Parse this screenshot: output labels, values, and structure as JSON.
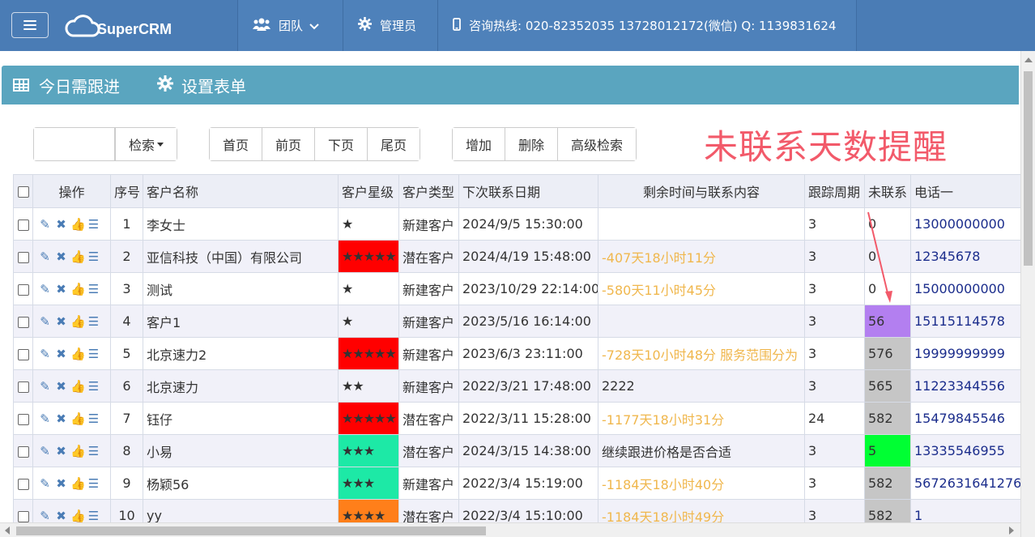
{
  "navbar": {
    "brand": "SuperCRM",
    "team_label": "团队",
    "admin_label": "管理员",
    "hotline": "咨询热线: 020-82352035 13728012172(微信) Q: 1139831624"
  },
  "panel": {
    "title": "今日需跟进",
    "settings": "设置表单"
  },
  "toolbar": {
    "search_value": "",
    "search_label": "检索",
    "first": "首页",
    "prev": "前页",
    "next": "下页",
    "last": "尾页",
    "add": "增加",
    "delete": "删除",
    "advanced": "高级检索"
  },
  "annotation": "未联系天数提醒",
  "table": {
    "headers": {
      "op": "操作",
      "idx": "序号",
      "name": "客户名称",
      "star": "客户星级",
      "type": "客户类型",
      "next_date": "下次联系日期",
      "remain": "剩余时间与联系内容",
      "cycle": "跟踪周期",
      "uncontacted": "未联系",
      "phone": "电话一"
    },
    "rows": [
      {
        "idx": "1",
        "name": "李女士",
        "stars": "★",
        "star_bg": "",
        "type": "新建客户",
        "date": "2024/9/5 15:30:00",
        "remain": "",
        "remain_warn": false,
        "cycle": "3",
        "days": "0",
        "days_bg": "",
        "phone": "13000000000"
      },
      {
        "idx": "2",
        "name": "亚信科技（中国）有限公司",
        "stars": "★★★★★",
        "star_bg": "#ff0000",
        "type": "潜在客户",
        "date": "2024/4/19 15:48:00",
        "remain": "-407天18小时11分",
        "remain_warn": true,
        "cycle": "3",
        "days": "0",
        "days_bg": "",
        "phone": "12345678"
      },
      {
        "idx": "3",
        "name": "测试",
        "stars": "★",
        "star_bg": "",
        "type": "新建客户",
        "date": "2023/10/29 22:14:00",
        "remain": "-580天11小时45分",
        "remain_warn": true,
        "cycle": "3",
        "days": "0",
        "days_bg": "",
        "phone": "15000000000"
      },
      {
        "idx": "4",
        "name": "客户1",
        "stars": "★",
        "star_bg": "",
        "type": "新建客户",
        "date": "2023/5/16 16:14:00",
        "remain": "",
        "remain_warn": false,
        "cycle": "3",
        "days": "56",
        "days_bg": "#b37ff0",
        "phone": "15115114578"
      },
      {
        "idx": "5",
        "name": "北京速力2",
        "stars": "★★★★★",
        "star_bg": "#ff0000",
        "type": "新建客户",
        "date": "2023/6/3 23:11:00",
        "remain": "-728天10小时48分 服务范围分为",
        "remain_warn": true,
        "cycle": "3",
        "days": "576",
        "days_bg": "#c6c6c6",
        "phone": "19999999999"
      },
      {
        "idx": "6",
        "name": "北京速力",
        "stars": "★★",
        "star_bg": "",
        "type": "新建客户",
        "date": "2022/3/21 17:48:00",
        "remain": "2222",
        "remain_warn": false,
        "cycle": "3",
        "days": "565",
        "days_bg": "#c6c6c6",
        "phone": "11223344556"
      },
      {
        "idx": "7",
        "name": "钰仔",
        "stars": "★★★★★",
        "star_bg": "#ff0000",
        "type": "潜在客户",
        "date": "2022/3/11 15:28:00",
        "remain": "-1177天18小时31分",
        "remain_warn": true,
        "cycle": "24",
        "days": "582",
        "days_bg": "#c6c6c6",
        "phone": "15479845546"
      },
      {
        "idx": "8",
        "name": "小易",
        "stars": "★★★",
        "star_bg": "#1de9a6",
        "type": "潜在客户",
        "date": "2024/3/15 14:38:00",
        "remain": "继续跟进价格是否合适",
        "remain_warn": false,
        "cycle": "3",
        "days": "5",
        "days_bg": "#00ff33",
        "phone": "13335546955"
      },
      {
        "idx": "9",
        "name": "杨颖56",
        "stars": "★★★",
        "star_bg": "#1de9a6",
        "type": "新建客户",
        "date": "2022/3/4 15:19:00",
        "remain": "-1184天18小时40分",
        "remain_warn": true,
        "cycle": "3",
        "days": "582",
        "days_bg": "#c6c6c6",
        "phone": "5672631641276"
      },
      {
        "idx": "10",
        "name": "yy",
        "stars": "★★★★",
        "star_bg": "#ff7f1a",
        "type": "潜在客户",
        "date": "2022/3/4 15:10:00",
        "remain": "-1184天18小时49分",
        "remain_warn": true,
        "cycle": "3",
        "days": "582",
        "days_bg": "#c6c6c6",
        "phone": "1"
      }
    ]
  }
}
